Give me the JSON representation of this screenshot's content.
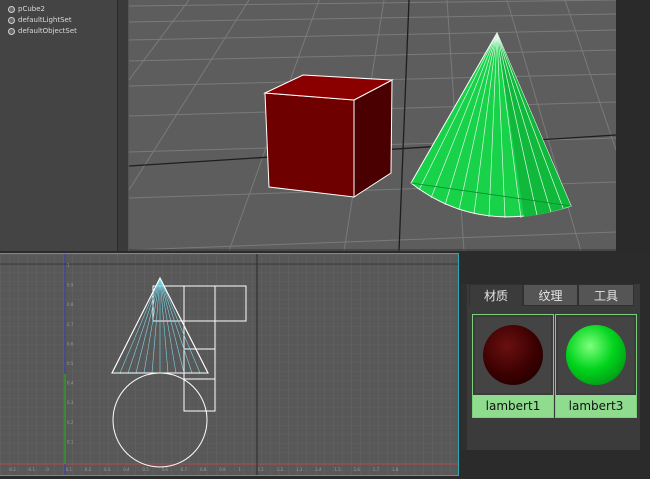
{
  "outliner": {
    "items": [
      {
        "label": "pCube2",
        "icon": "mesh-icon"
      },
      {
        "label": "defaultLightSet",
        "icon": "set-icon"
      },
      {
        "label": "defaultObjectSet",
        "icon": "set-icon"
      }
    ]
  },
  "uv_editor": {
    "x_ticks": [
      "-0.2",
      "-0.1",
      "0",
      "0.1",
      "0.2",
      "0.3",
      "0.4",
      "0.5",
      "0.6",
      "0.7",
      "0.8",
      "0.9",
      "1",
      "1.1",
      "1.2",
      "1.3",
      "1.4",
      "1.5",
      "1.6",
      "1.7",
      "1.8"
    ],
    "y_ticks": [
      "1",
      "0.9",
      "0.8",
      "0.7",
      "0.6",
      "0.5",
      "0.4",
      "0.3",
      "0.2",
      "0.1"
    ]
  },
  "hypershade": {
    "tabs": [
      "材质",
      "纹理",
      "工具"
    ],
    "active_tab": "材质",
    "materials": [
      {
        "name": "lambert1",
        "color": "#5a0000"
      },
      {
        "name": "lambert3",
        "color": "#00e020"
      }
    ]
  },
  "colors": {
    "cube": "#6e0000",
    "cone": "#18d24a",
    "selection_highlight": "#8fdc8f",
    "uv_border": "#2fa7b4"
  }
}
